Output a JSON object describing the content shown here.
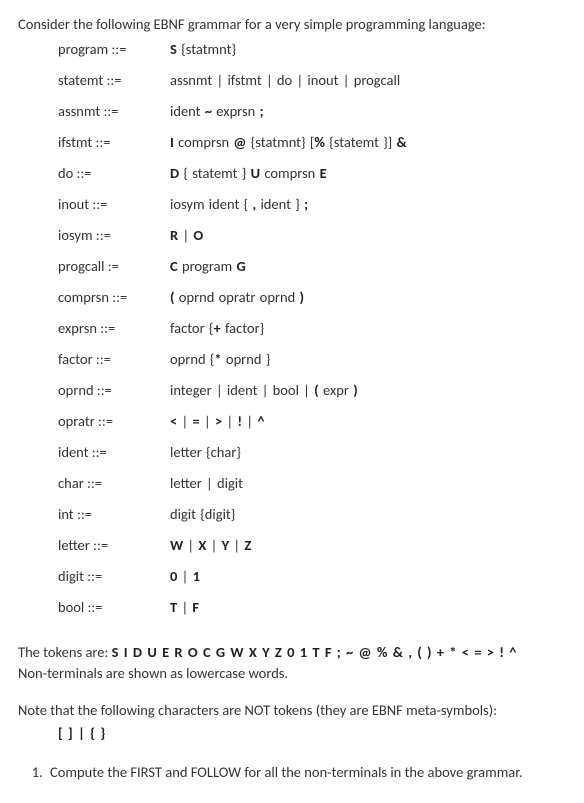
{
  "intro": "Consider the following EBNF grammar for a very simple programming language:",
  "rules": [
    {
      "lhs": "program ::=",
      "rhs": "<b>S</b> {statmnt}"
    },
    {
      "lhs": "statemt ::=",
      "rhs": "assnmt | ifstmt | do | inout | progcall"
    },
    {
      "lhs": "assnmt  ::=",
      "rhs": "ident <b>~</b> exprsn <b>;</b>"
    },
    {
      "lhs": "ifstmt  ::=",
      "rhs": "<b>I</b> comprsn <b>@</b> {statmnt} [<b>%</b> {statemt }] <b>&</b>"
    },
    {
      "lhs": "do ::=",
      "rhs": "<b>D</b> { statemt } <b>U</b> comprsn  <b>E</b>"
    },
    {
      "lhs": "inout    ::=",
      "rhs": "iosym ident { <b>,</b> ident } <b>;</b>"
    },
    {
      "lhs": "iosym  ::=",
      "rhs": "<b>R</b> | <b>O</b>"
    },
    {
      "lhs": "progcall :=",
      "rhs": "<b>C</b> program <b>G</b>"
    },
    {
      "lhs": "comprsn ::=",
      "rhs": "<b>(</b> oprnd opratr oprnd <b>)</b>"
    },
    {
      "lhs": "exprsn ::=",
      "rhs": "factor {<b>+</b> factor}"
    },
    {
      "lhs": "factor  ::=",
      "rhs": "oprnd {<b>*</b> oprnd }"
    },
    {
      "lhs": "oprnd   ::=",
      "rhs": "integer | ident | bool | <b>(</b> expr <b>)</b>"
    },
    {
      "lhs": "opratr  ::=",
      "rhs": "<b>&lt;</b> | <b>=</b> | <b>&gt;</b> | <b>!</b> | <b>^</b>"
    },
    {
      "lhs": "ident   ::=",
      "rhs": "letter {char}"
    },
    {
      "lhs": "char    ::=",
      "rhs": "letter | digit"
    },
    {
      "lhs": "int ::=",
      "rhs": "digit {digit}"
    },
    {
      "lhs": "letter  ::=",
      "rhs": "<b>W</b> | <b>X</b> | <b>Y</b> | <b>Z</b>"
    },
    {
      "lhs": "digit   ::=",
      "rhs": "<b>0</b> | <b>1</b>"
    },
    {
      "lhs": "bool ::=",
      "rhs": "<b>T</b> | <b>F</b>"
    }
  ],
  "tokens_prefix": "The tokens are: ",
  "tokens": "S I D U E R O C G W X Y Z 0 1 T F ; ~ @ % & , ( ) + * < = > ! ^",
  "nonterminals_note": "Non-terminals are shown as lowercase words.",
  "meta_note": "Note that the following characters are NOT tokens (they are EBNF meta-symbols):",
  "meta_symbols": "[  ] |  {  }",
  "question_1": "Compute the FIRST and FOLLOW for all the non-terminals in the above grammar."
}
